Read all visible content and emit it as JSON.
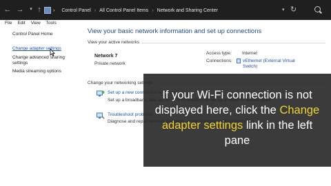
{
  "window": {
    "nav": {
      "back": "←",
      "forward": "→",
      "dropdown": "▾",
      "up": "↑",
      "refresh": "↻",
      "address_dropdown": "▾"
    },
    "breadcrumb": [
      "Control Panel",
      "All Control Panel Items",
      "Network and Sharing Center"
    ],
    "breadcrumb_separator": "›"
  },
  "menu": [
    "File",
    "Edit",
    "View",
    "Tools"
  ],
  "sidebar": {
    "home": "Control Panel Home",
    "adapter": "Change adapter settings",
    "sharing": "Change advanced sharing settings",
    "media": "Media streaming options"
  },
  "main": {
    "heading": "View your basic network information and set up connections",
    "active_label": "View your active networks",
    "network_name": "Network 7",
    "network_type": "Private network",
    "access_label": "Access type:",
    "access_value": "Internet",
    "connections_label": "Connections:",
    "connections_value": "vEthernet (External Virtual Switch)",
    "change_label": "Change your networking settings",
    "task1_link": "Set up a new connection or network",
    "task1_desc": "Set up a broadband, dial-up, or VPN connection; or set up a router or access point.",
    "task2_link": "Troubleshoot problems",
    "task2_desc": "Diagnose and repair network problems, or get troubleshooting information."
  },
  "overlay": {
    "part1": "If your Wi-Fi connection is not displayed here, click the ",
    "highlight": "Change adapter settings",
    "part2": " link in the left pane"
  },
  "colors": {
    "link": "#1e4ea8",
    "heading": "#1e4b8c",
    "highlight": "#f2d230"
  }
}
